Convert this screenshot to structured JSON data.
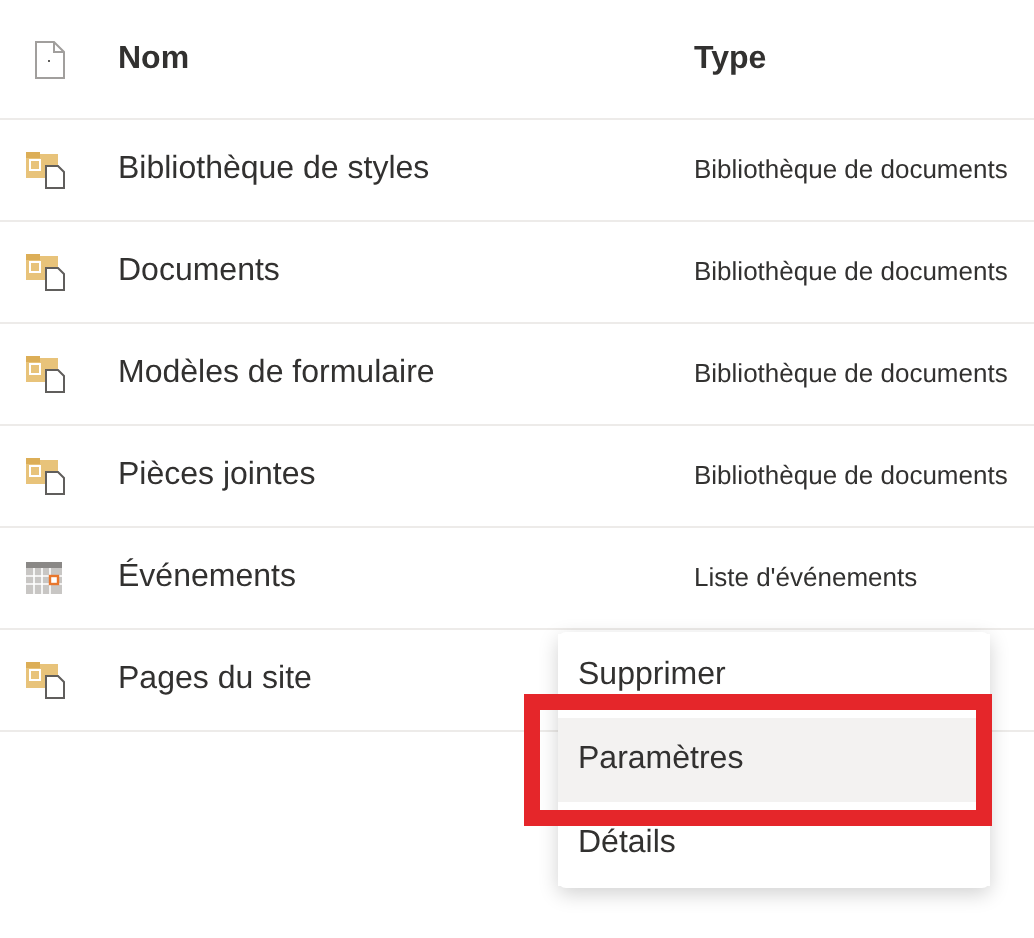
{
  "table": {
    "columns": [
      {
        "label": "Nom"
      },
      {
        "label": "Type"
      }
    ],
    "rows": [
      {
        "kind": "library",
        "name": "Bibliothèque de styles",
        "type": "Bibliothèque de documents"
      },
      {
        "kind": "library",
        "name": "Documents",
        "type": "Bibliothèque de documents"
      },
      {
        "kind": "library",
        "name": "Modèles de formulaire",
        "type": "Bibliothèque de documents"
      },
      {
        "kind": "library",
        "name": "Pièces jointes",
        "type": "Bibliothèque de documents"
      },
      {
        "kind": "calendar",
        "name": "Événements",
        "type": "Liste d'événements"
      },
      {
        "kind": "library",
        "name": "Pages du site"
      }
    ]
  },
  "context_menu": {
    "items": [
      {
        "label": "Supprimer",
        "selected": false,
        "highlighted": false
      },
      {
        "label": "Paramètres",
        "selected": true,
        "highlighted": true
      },
      {
        "label": "Détails",
        "selected": false,
        "highlighted": false
      }
    ]
  }
}
